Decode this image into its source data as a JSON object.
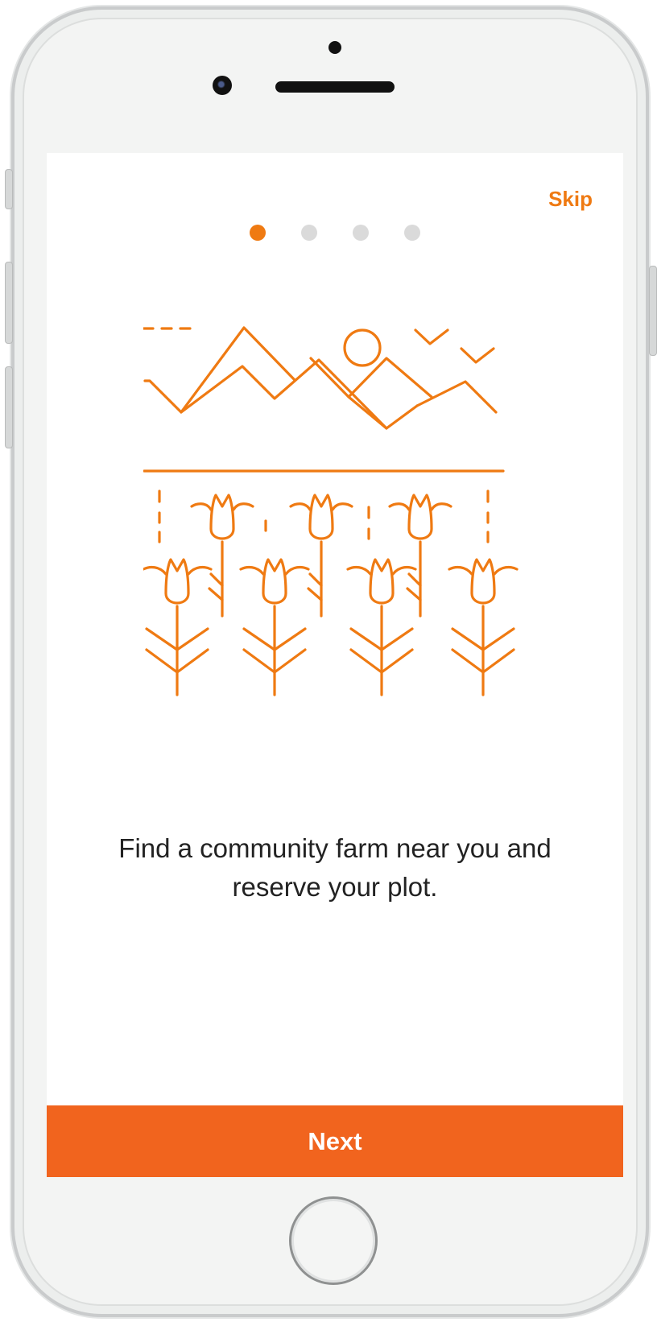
{
  "onboarding": {
    "skip_label": "Skip",
    "page_indicator": {
      "total": 4,
      "current": 1
    },
    "illustration_icon": "farm-field-illustration",
    "caption": "Find a community farm near you and reserve your plot.",
    "next_label": "Next"
  },
  "colors": {
    "accent": "#ef7a12",
    "button": "#f1641e",
    "dot_inactive": "#dadada",
    "text": "#222222"
  }
}
